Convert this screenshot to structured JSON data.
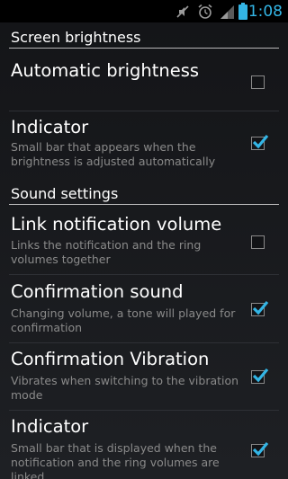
{
  "status_bar": {
    "time": "1:08",
    "icons": [
      "mute-icon",
      "alarm-icon",
      "signal-icon",
      "battery-icon"
    ],
    "accent_color": "#33b5e5"
  },
  "sections": {
    "screen": {
      "title": "Screen brightness",
      "auto": {
        "title": "Automatic brightness",
        "checked": false
      },
      "indicator": {
        "title": "Indicator",
        "summary": "Small bar that appears when the brightness is adjusted automatically",
        "checked": true
      }
    },
    "sound": {
      "title": "Sound settings",
      "link": {
        "title": "Link notification volume",
        "summary": "Links the notification and the ring volumes together",
        "checked": false
      },
      "confirm_sound": {
        "title": "Confirmation sound",
        "summary": "Changing volume, a tone will played for confirmation",
        "checked": true
      },
      "confirm_vibration": {
        "title": "Confirmation Vibration",
        "summary": "Vibrates when switching to the vibration mode",
        "checked": true
      },
      "indicator": {
        "title": "Indicator",
        "summary": "Small bar that is displayed when the notification and the ring volumes are linked",
        "checked": true
      }
    }
  }
}
